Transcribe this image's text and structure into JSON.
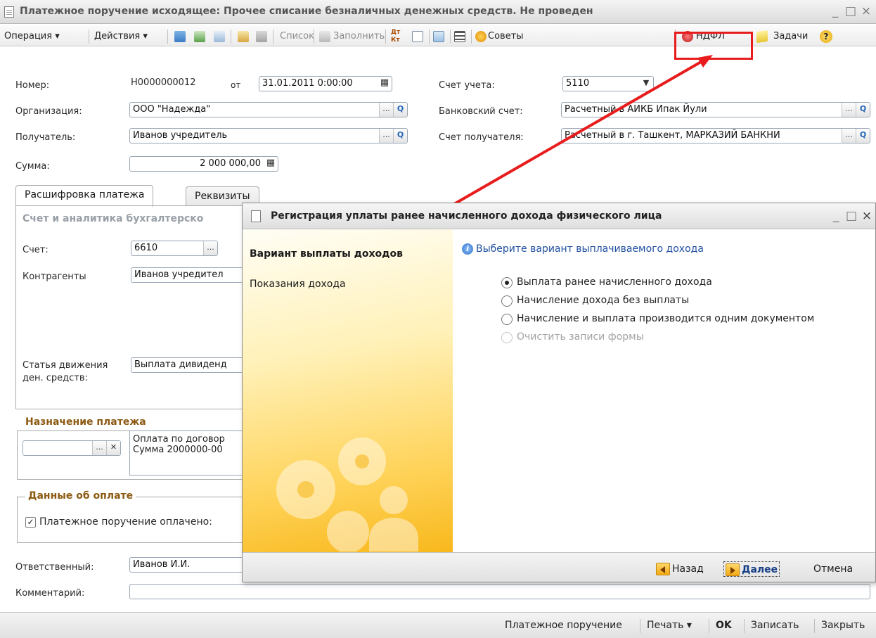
{
  "window": {
    "title": "Платежное поручение исходящее: Прочее списание безналичных денежных средств. Не проведен",
    "minimize": "_",
    "maximize": "□",
    "close": "×"
  },
  "toolbar": {
    "operation": "Операция ▾",
    "actions": "Действия ▾",
    "list": "Список",
    "fill": "Заполнить",
    "dt_kt": "Дт Кт",
    "tips": "Советы",
    "ndfl": "НДФЛ",
    "tasks": "Задачи",
    "help": "?"
  },
  "form": {
    "number_label": "Номер:",
    "number_value": "Н0000000012",
    "from_label": "от",
    "date_value": "31.01.2011  0:00:00",
    "account_label": "Счет учета:",
    "account_value": "5110",
    "org_label": "Организация:",
    "org_value": "ООО \"Надежда\"",
    "bank_account_label": "Банковский счет:",
    "bank_account_value": "Расчетный в АИКБ Ипак Йули",
    "recipient_label": "Получатель:",
    "recipient_value": "Иванов учредитель",
    "recipient_account_label": "Счет получателя:",
    "recipient_account_value": "Расчетный в г. Ташкент, МАРКАЗИЙ БАНКНИ",
    "sum_label": "Сумма:",
    "sum_value": "2 000 000,00"
  },
  "tabs": [
    {
      "label": "Расшифровка платежа"
    },
    {
      "label": "Реквизиты"
    }
  ],
  "payment_details": {
    "section_title": "Счет и аналитика бухгалтерско",
    "account_label": "Счет:",
    "account_value": "6610",
    "contractors_label": "Контрагенты",
    "contractors_value": "Иванов учредител",
    "cash_flow_label_1": "Статья движения",
    "cash_flow_label_2": "ден. средств:",
    "cash_flow_value": "Выплата дивиденд",
    "purpose_title": "Назначение платежа",
    "purpose_text_1": "Оплата по договор",
    "purpose_text_2": "Сумма 2000000-00",
    "paid_title": "Данные об оплате",
    "paid_checkbox_label": "Платежное поручение оплачено:"
  },
  "bottom_form": {
    "responsible_label": "Ответственный:",
    "responsible_value": "Иванов И.И.",
    "comment_label": "Комментарий:",
    "comment_value": ""
  },
  "footer": {
    "payment_order": "Платежное поручение",
    "print": "Печать ▾",
    "ok": "OK",
    "save": "Записать",
    "close": "Закрыть"
  },
  "dialog": {
    "title": "Регистрация уплаты ранее начисленного дохода физического лица",
    "steps": [
      {
        "label": "Вариант выплаты доходов"
      },
      {
        "label": "Показания дохода"
      }
    ],
    "hint": "Выберите вариант выплачиваемого дохода",
    "options": [
      {
        "label": "Выплата ранее начисленного дохода",
        "selected": true,
        "disabled": false
      },
      {
        "label": "Начисление дохода без выплаты",
        "selected": false,
        "disabled": false
      },
      {
        "label": "Начисление и выплата производится одним документом",
        "selected": false,
        "disabled": false
      },
      {
        "label": "Очистить записи формы",
        "selected": false,
        "disabled": true
      }
    ],
    "back": "Назад",
    "next": "Далее",
    "cancel": "Отмена"
  },
  "colors": {
    "highlight": "#e81c1c",
    "section_title": "#8c5a12",
    "dialog_gradient_end": "#f8b81c"
  }
}
